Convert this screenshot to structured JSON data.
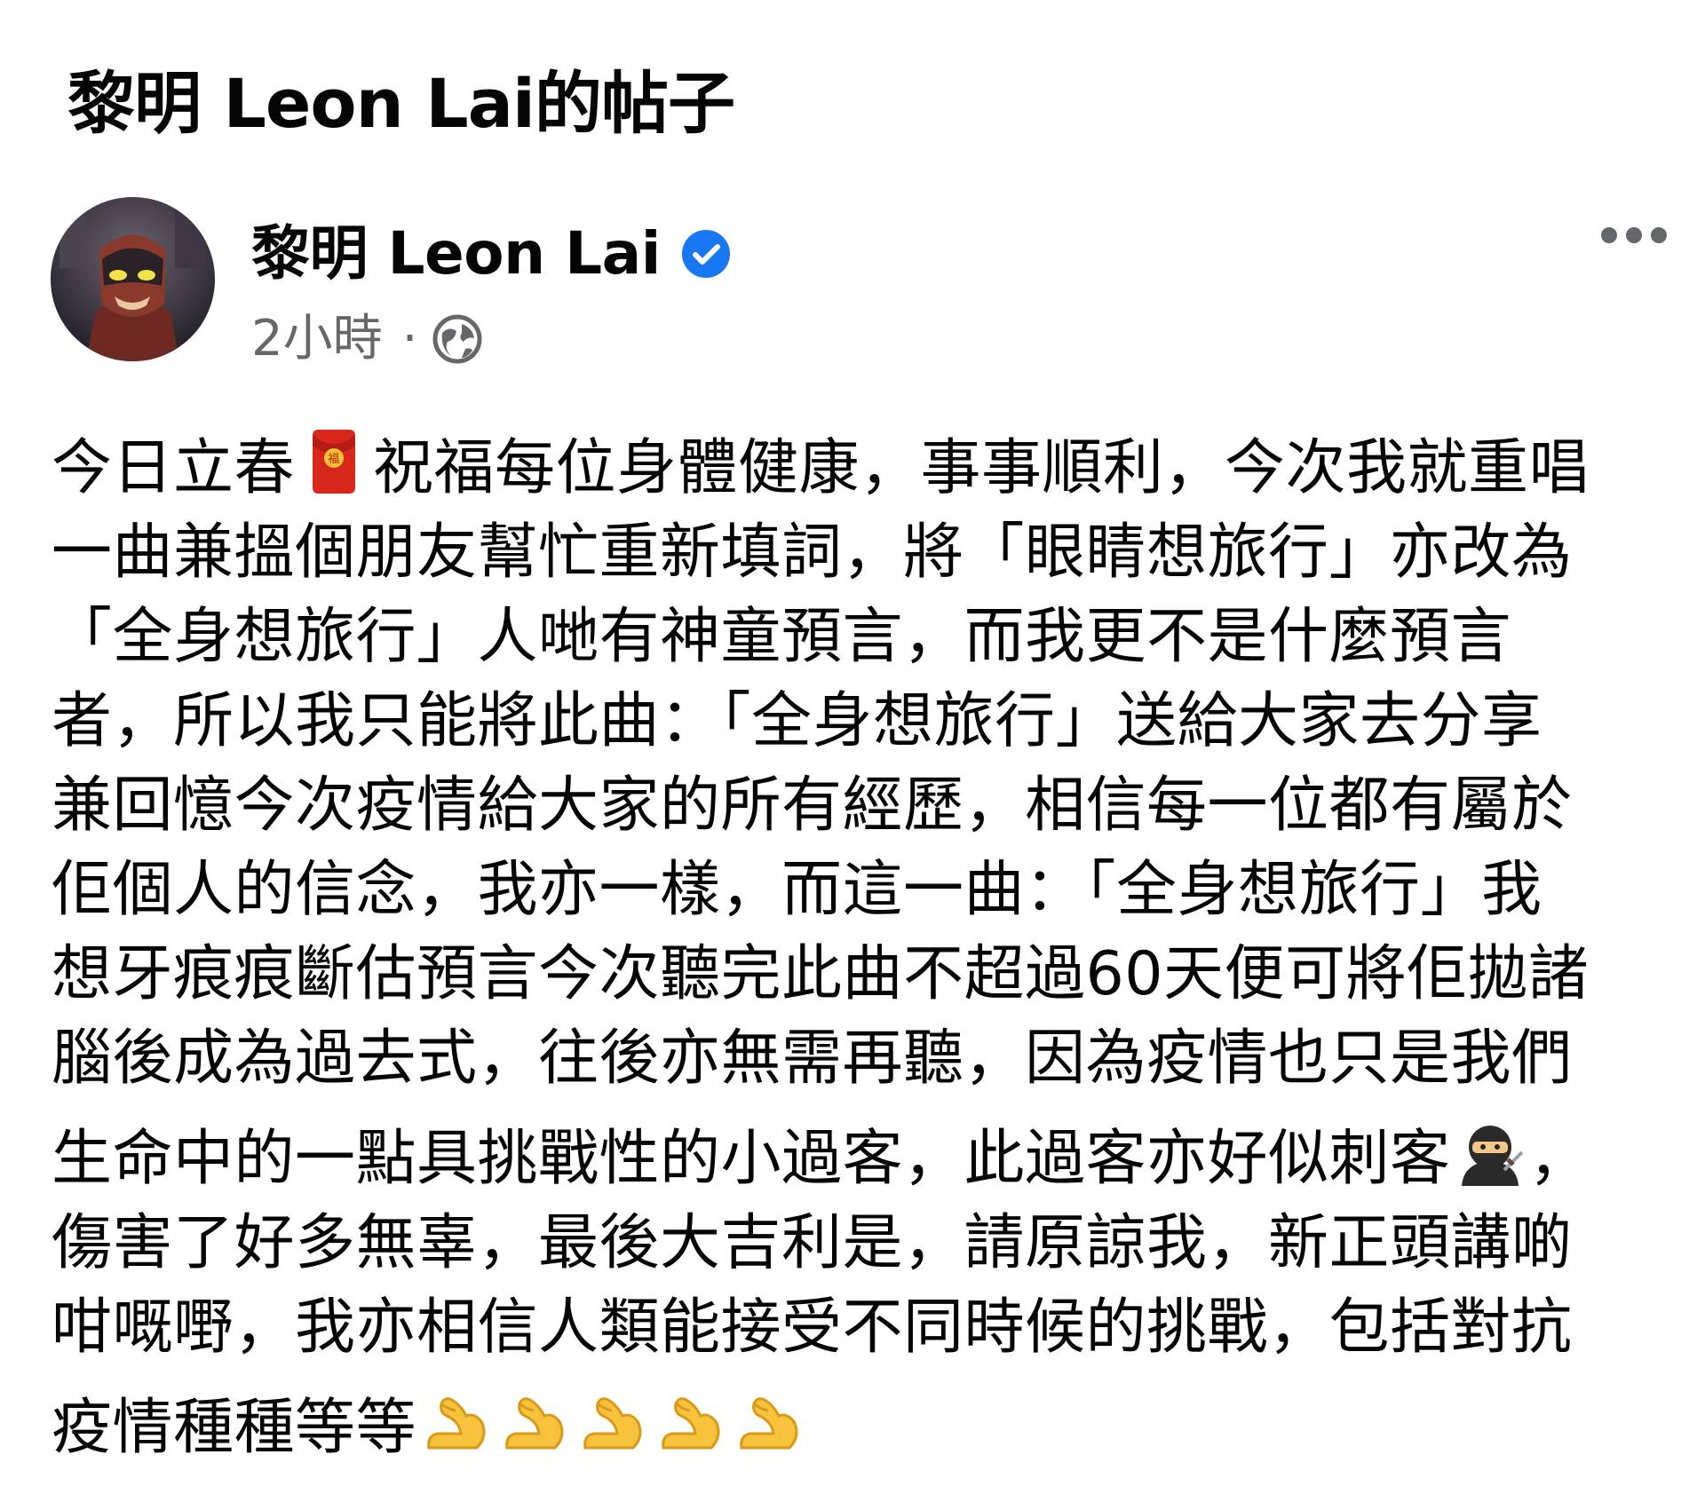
{
  "page": {
    "title": "黎明 Leon Lai的帖子"
  },
  "post": {
    "author_name": "黎明 Leon Lai",
    "verified": true,
    "timestamp": "2小時",
    "separator": "·",
    "audience_icon": "globe-icon",
    "more_icon": "more-options-icon",
    "lines": [
      "今日立春",
      "祝福每位身體健康，事事順利，今次我就重唱",
      "一曲兼搵個朋友幫忙重新填詞，將「眼睛想旅行」亦改為",
      "「全身想旅行」人哋有神童預言，而我更不是什麼預言",
      "者，所以我只能將此曲：「全身想旅行」送給大家去分享",
      "兼回憶今次疫情給大家的所有經歷，相信每一位都有屬於",
      "佢個人的信念，我亦一樣，而這一曲：「全身想旅行」我",
      "想牙痕痕斷估預言今次聽完此曲不超過60天便可將佢拋諸",
      "腦後成為過去式，往後亦無需再聽，因為疫情也只是我們",
      "生命中的一點具挑戰性的小過客，此過客亦好似刺客",
      "，",
      "傷害了好多無辜，最後大吉利是，請原諒我，新正頭講啲",
      "咁嘅嘢，我亦相信人類能接受不同時候的挑戰，包括對抗",
      "疫情種種等等"
    ],
    "emojis": {
      "red_envelope": "red-envelope-emoji",
      "ninja": "ninja-emoji",
      "flexed_biceps": "flexed-biceps-emoji",
      "flexed_biceps_count": 5
    }
  },
  "colors": {
    "text_primary": "#050505",
    "text_secondary": "#65676b",
    "verified_blue": "#1877f2",
    "background": "#ffffff"
  }
}
